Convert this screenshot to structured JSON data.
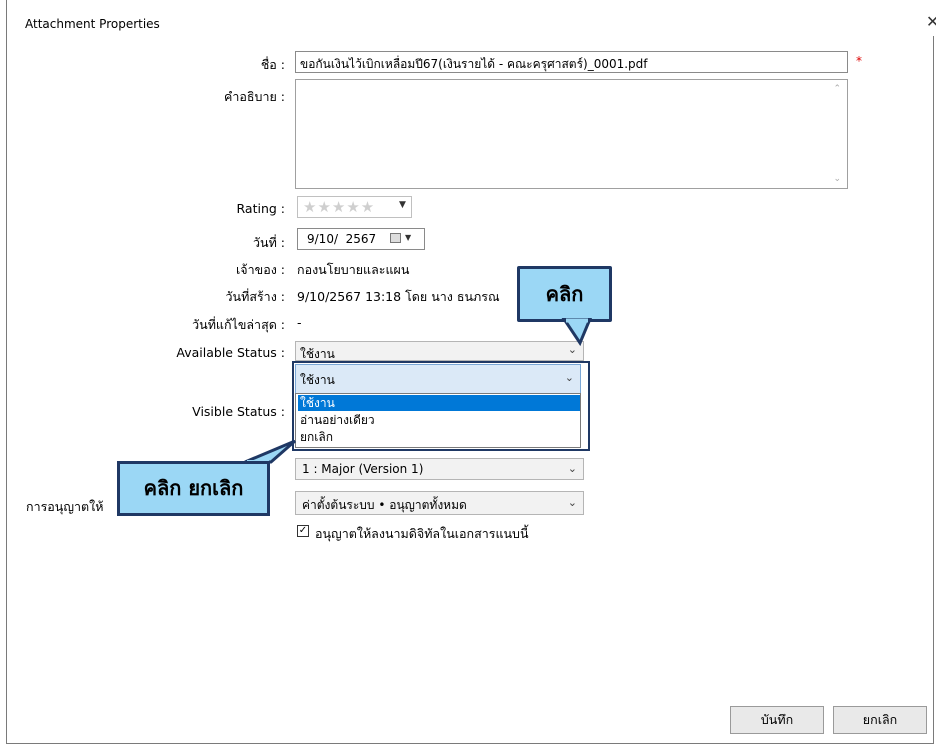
{
  "window": {
    "title": "Attachment Properties"
  },
  "form": {
    "name_label": "ชื่อ :",
    "name_value": "ขอกันเงินไว้เบิกเหลื่อมปี67(เงินรายได้ - คณะครุศาสตร์)_0001.pdf",
    "required_mark": "*",
    "description_label": "คำอธิบาย :",
    "rating_label": "Rating :",
    "rating_stars": "★★★★★",
    "date_label": "วันที่ :",
    "date_value": "9/10/  2567",
    "owner_label": "เจ้าของ :",
    "owner_value": "กองนโยบายและแผน",
    "created_label": "วันที่สร้าง :",
    "created_value": "9/10/2567 13:18 โดย นาง ธนภรณ",
    "modified_label": "วันที่แก้ไขล่าสุด :",
    "modified_value": "-",
    "available_label": "Available Status :",
    "available_value": "ใช้งาน",
    "visible_label": "Visible Status :",
    "version_value": "1 : Major (Version 1)",
    "permission_label": "การอนุญาตให้",
    "permission_value": "ค่าตั้งต้นระบบ • อนุญาตทั้งหมด",
    "signature_checkbox": "อนุญาตให้ลงนามดิจิทัลในเอกสารแนบนี้"
  },
  "dropdown": {
    "selected": "ใช้งาน",
    "options": [
      "ใช้งาน",
      "อ่านอย่างเดียว",
      "ยกเลิก"
    ]
  },
  "buttons": {
    "save": "บันทึก",
    "cancel": "ยกเลิก"
  },
  "callouts": {
    "click": "คลิก",
    "click_cancel": "คลิก ยกเลิก"
  },
  "colors": {
    "highlight": "#0078d7",
    "callout_fill": "#9bd7f5",
    "callout_border": "#1f3864",
    "required": "#dd0000"
  },
  "icons": {
    "close": "close-icon",
    "calendar": "calendar-icon",
    "chevron": "chevron-down-icon",
    "checkbox": "checkbox-checked-icon"
  }
}
